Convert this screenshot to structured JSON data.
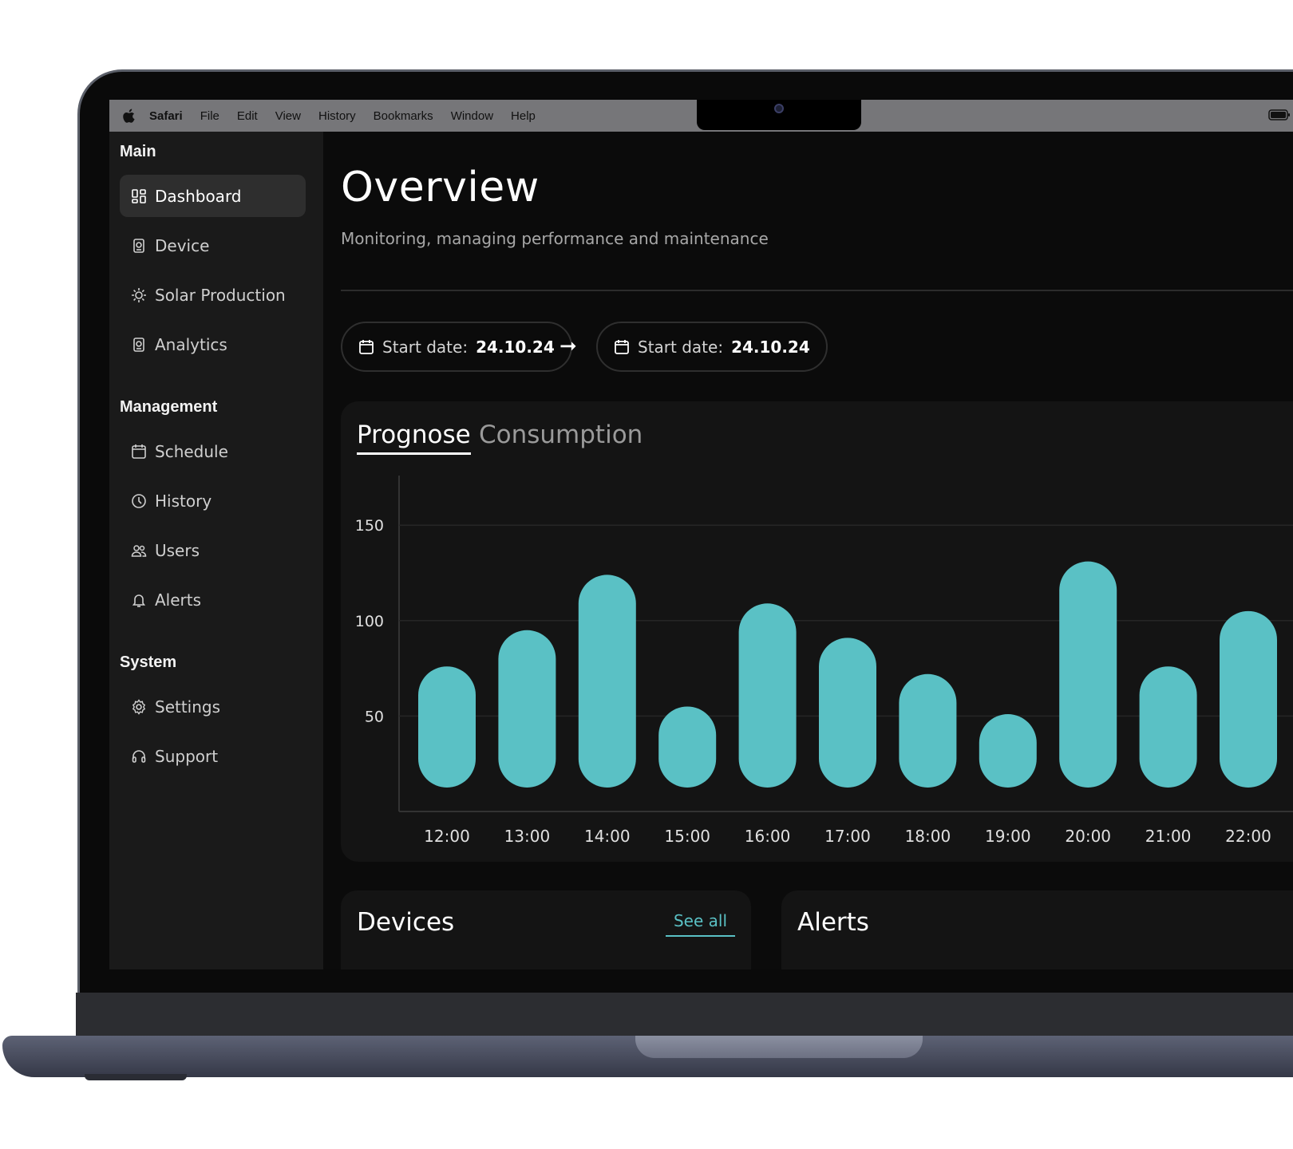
{
  "menubar": {
    "app": "Safari",
    "items": [
      "File",
      "Edit",
      "View",
      "History",
      "Bookmarks",
      "Window",
      "Help"
    ]
  },
  "sidebar": {
    "sections": [
      {
        "title": "Main",
        "items": [
          {
            "label": "Dashboard",
            "icon": "dashboard-icon",
            "active": true
          },
          {
            "label": "Device",
            "icon": "device-icon"
          },
          {
            "label": "Solar Production",
            "icon": "sun-icon"
          },
          {
            "label": "Analytics",
            "icon": "analytics-icon"
          }
        ]
      },
      {
        "title": "Management",
        "items": [
          {
            "label": "Schedule",
            "icon": "calendar-icon"
          },
          {
            "label": "History",
            "icon": "clock-icon"
          },
          {
            "label": "Users",
            "icon": "users-icon"
          },
          {
            "label": "Alerts",
            "icon": "bell-icon"
          }
        ]
      },
      {
        "title": "System",
        "items": [
          {
            "label": "Settings",
            "icon": "gear-icon"
          },
          {
            "label": "Support",
            "icon": "headset-icon"
          }
        ]
      }
    ]
  },
  "main": {
    "title": "Overview",
    "subtitle": "Monitoring, managing performance and maintenance",
    "date_from": {
      "label": "Start date:",
      "value": "24.10.24"
    },
    "date_to": {
      "label": "Start date:",
      "value": "24.10.24"
    },
    "tabs": [
      {
        "label": "Prognose",
        "active": true
      },
      {
        "label": "Consumption",
        "active": false
      }
    ],
    "devices": {
      "title": "Devices",
      "see_all": "See all"
    },
    "alerts": {
      "title": "Alerts"
    }
  },
  "colors": {
    "accent": "#5ac1c5",
    "background": "#0b0b0b",
    "sidebar": "#1a1a1a"
  },
  "chart_data": {
    "type": "bar",
    "categories": [
      "12:00",
      "13:00",
      "14:00",
      "15:00",
      "16:00",
      "17:00",
      "18:00",
      "19:00",
      "20:00",
      "21:00",
      "22:00"
    ],
    "values": [
      76,
      95,
      124,
      55,
      109,
      91,
      72,
      51,
      131,
      76,
      105
    ],
    "y_ticks": [
      "50",
      "100",
      "150"
    ],
    "ylim": [
      0,
      176
    ],
    "grid": true
  }
}
